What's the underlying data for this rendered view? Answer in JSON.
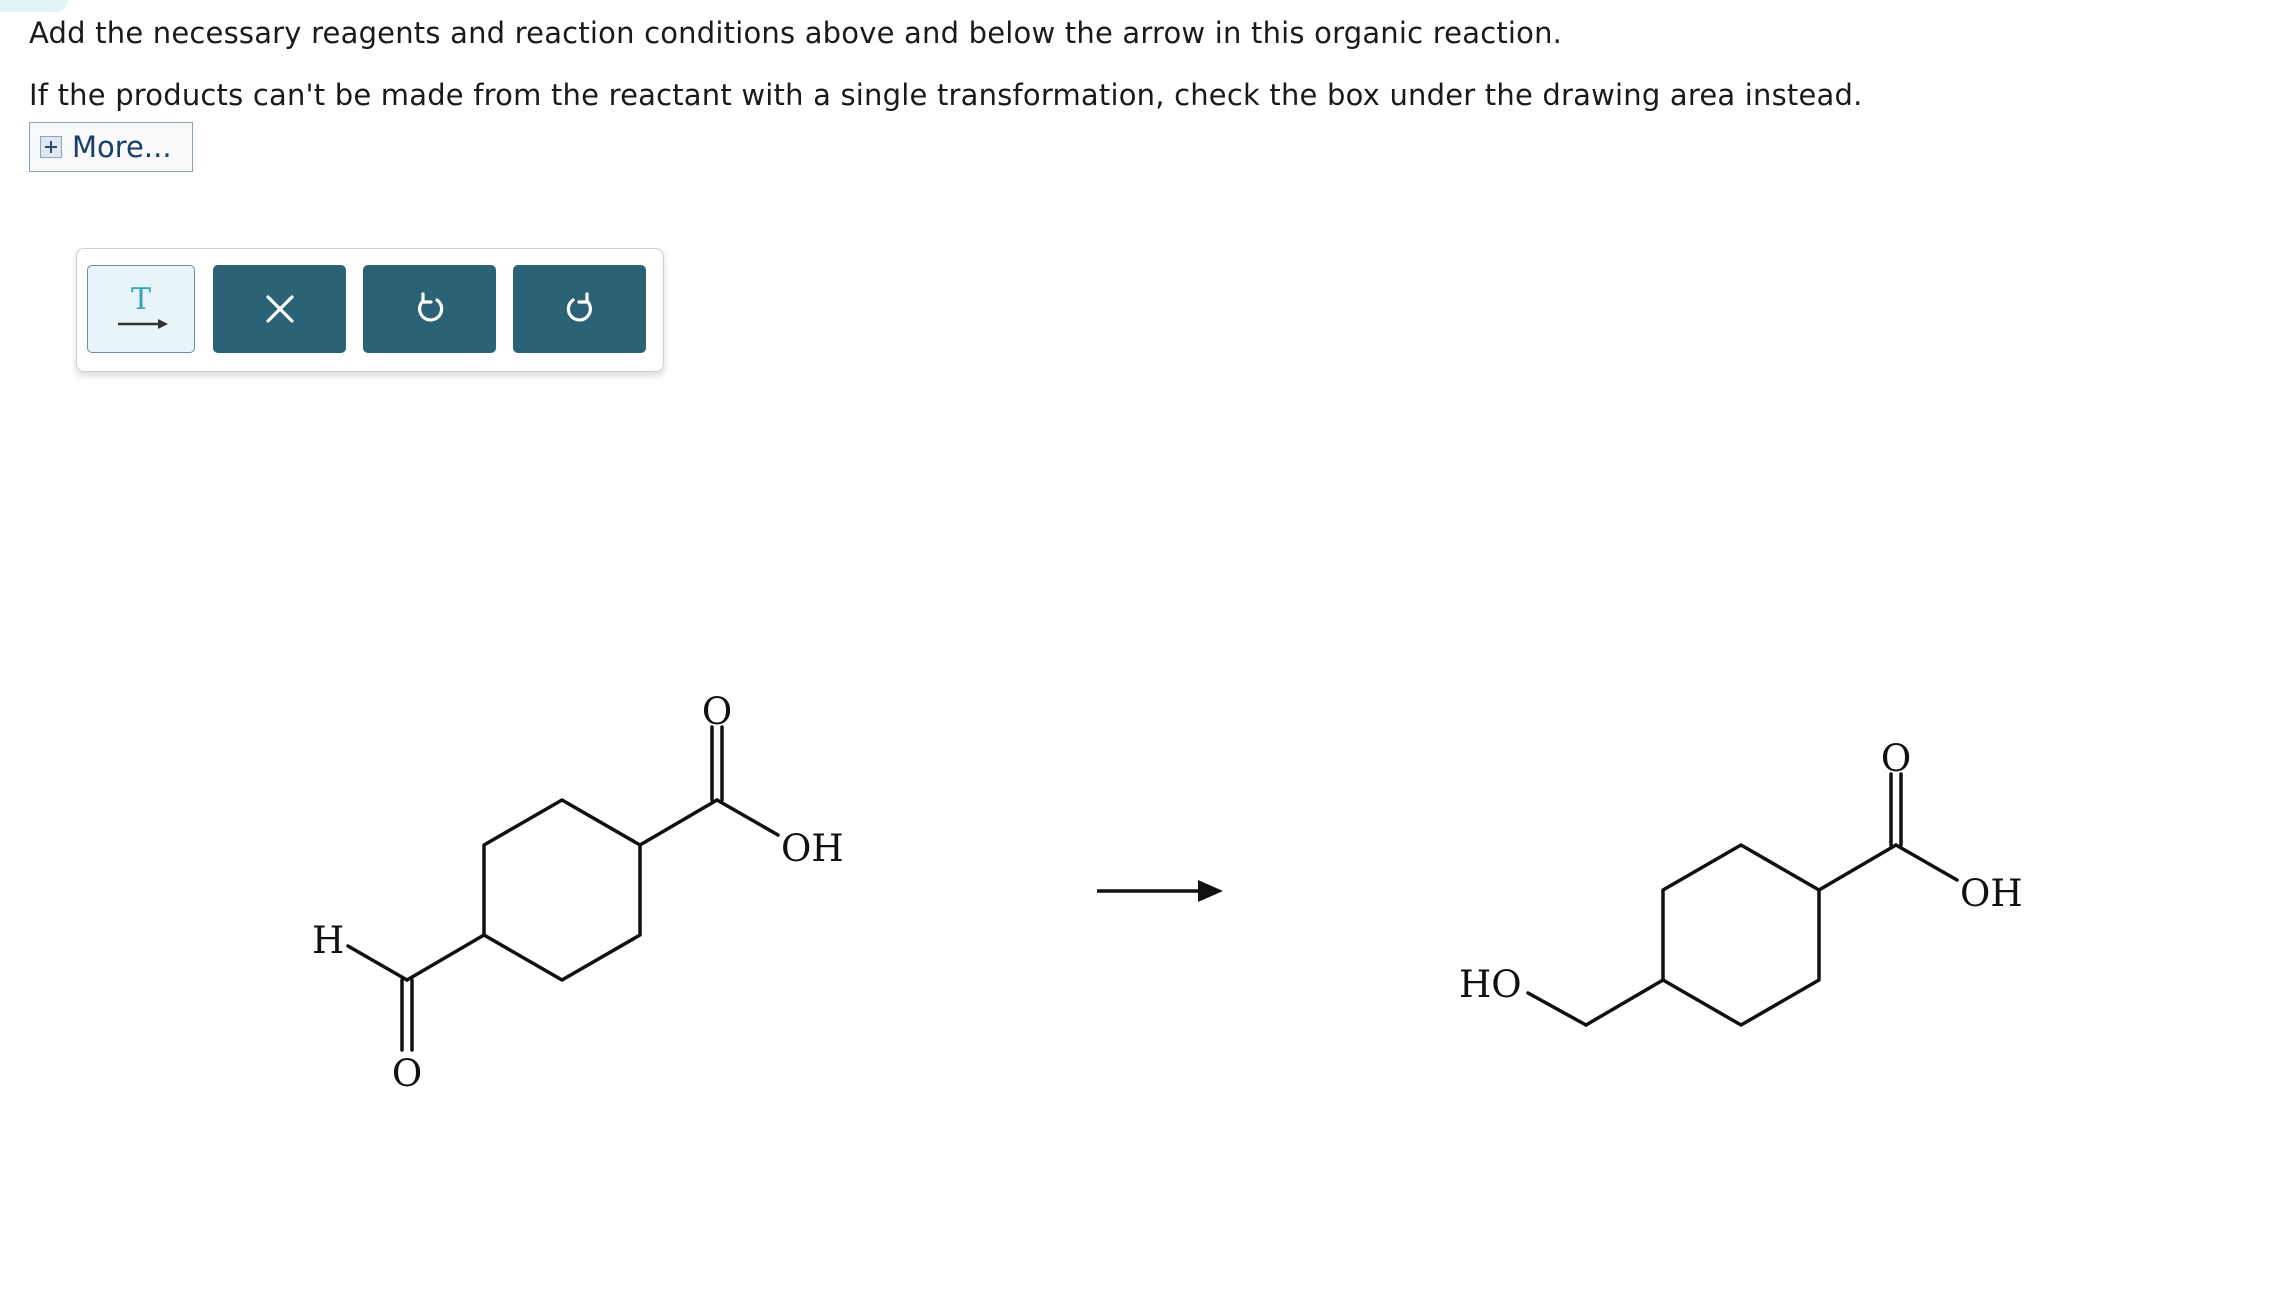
{
  "instructions": {
    "line1": "Add the necessary reagents and reaction conditions above and below the arrow in this organic reaction.",
    "line2": "If the products can't be made from the reactant with a single transformation, check the box under the drawing area instead."
  },
  "more_button": {
    "label": "More..."
  },
  "toolbar": {
    "tools": [
      {
        "name": "text-arrow",
        "icon": "text-on-arrow-icon",
        "glyph": "T"
      },
      {
        "name": "clear",
        "icon": "close-icon"
      },
      {
        "name": "undo",
        "icon": "undo-icon"
      },
      {
        "name": "redo",
        "icon": "redo-icon"
      }
    ]
  },
  "colors": {
    "toolbar_button": "#2b6276",
    "text_tool_bg": "#e8f5f8",
    "text_tool_accent": "#3aa0bf"
  },
  "reaction": {
    "reactant": {
      "labels": {
        "aldehyde_h": "H",
        "aldehyde_o": "O",
        "carbonyl_o": "O",
        "hydroxyl": "OH"
      }
    },
    "product": {
      "labels": {
        "alcohol": "HO",
        "carbonyl_o": "O",
        "hydroxyl": "OH"
      }
    }
  }
}
